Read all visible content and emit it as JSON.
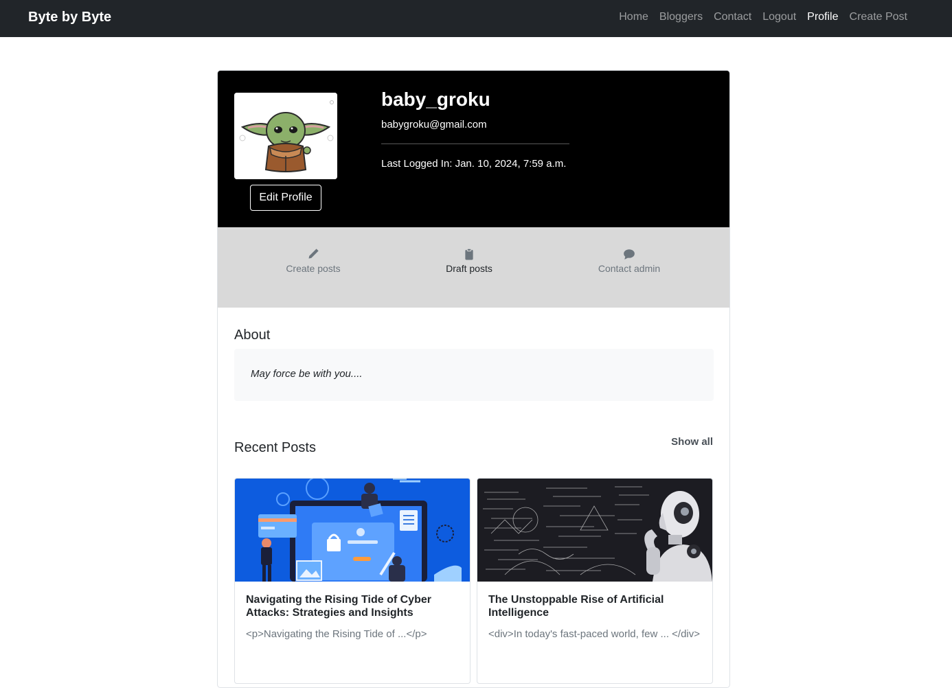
{
  "navbar": {
    "brand": "Byte by Byte",
    "links": [
      {
        "label": "Home"
      },
      {
        "label": "Bloggers"
      },
      {
        "label": "Contact"
      },
      {
        "label": "Logout"
      },
      {
        "label": "Profile",
        "active": true
      },
      {
        "label": "Create Post"
      }
    ]
  },
  "profile": {
    "username": "baby_groku",
    "email": "babygroku@gmail.com",
    "last_login": "Last Logged In: Jan. 10, 2024, 7:59 a.m.",
    "edit_label": "Edit Profile",
    "avatar_icon": "baby-yoda-avatar"
  },
  "actions": [
    {
      "label": "Create posts",
      "icon": "pencil-icon"
    },
    {
      "label": "Draft posts",
      "icon": "clipboard-icon"
    },
    {
      "label": "Contact admin",
      "icon": "chat-bubble-icon"
    }
  ],
  "about": {
    "title": "About",
    "text": "May force be with you...."
  },
  "recent": {
    "title": "Recent Posts",
    "show_all": "Show all",
    "posts": [
      {
        "title": "Navigating the Rising Tide of Cyber Attacks: Strategies and Insights",
        "excerpt": "<p>Navigating the Rising Tide of ...</p>",
        "image": "cyber-security-illustration"
      },
      {
        "title": "The Unstoppable Rise of Artificial Intelligence",
        "excerpt": "<div>In today's fast-paced world, few ... </div>",
        "image": "robot-thinking-math-board"
      }
    ]
  },
  "colors": {
    "navbar_bg": "#212529",
    "header_bg": "#000000",
    "stats_bg": "#d9d9d9",
    "about_bg": "#f8f9fa"
  }
}
